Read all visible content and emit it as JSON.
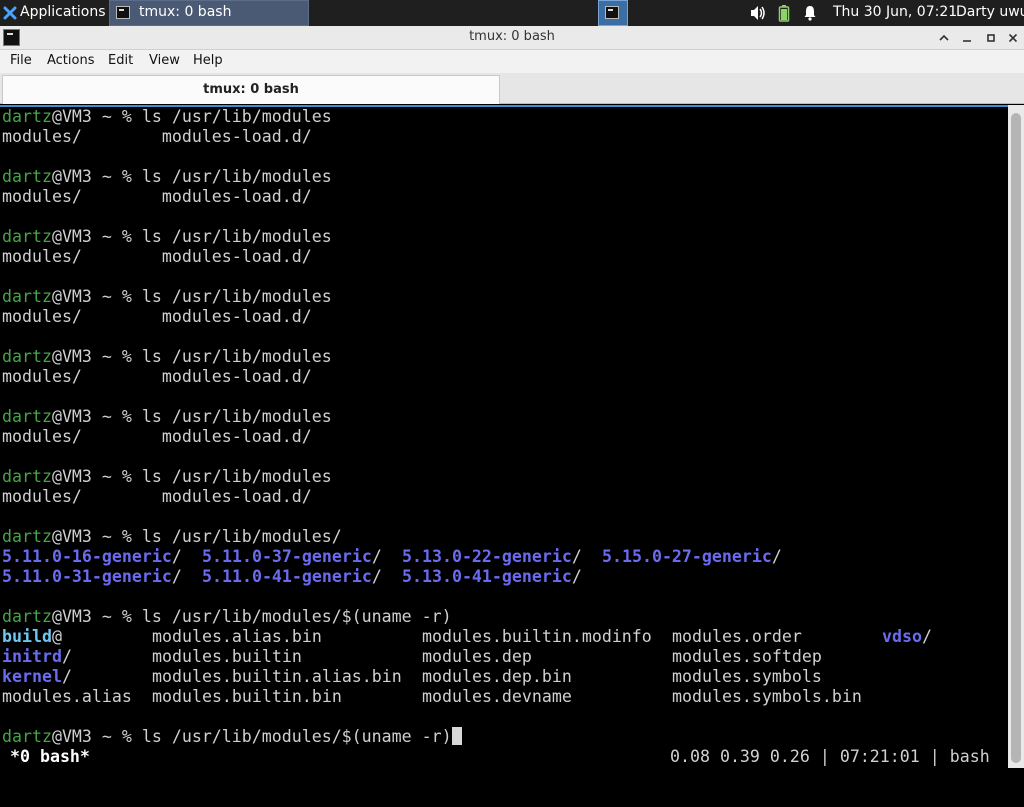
{
  "panel": {
    "applications_label": "Applications",
    "task_label": "tmux: 0 bash",
    "clock": "Thu 30 Jun, 07:21",
    "user": "Darty uwu",
    "icons": [
      "xfce-logo-icon",
      "terminal-icon",
      "volume-icon",
      "battery-icon",
      "notification-bell-icon"
    ]
  },
  "window": {
    "title": "tmux: 0 bash",
    "menu": [
      "File",
      "Actions",
      "Edit",
      "View",
      "Help"
    ],
    "tab_label": "tmux: 0 bash"
  },
  "colors": {
    "prompt_user": "#46a346",
    "directory": "#6b6bf0",
    "symlink": "#6ec8f2",
    "text": "#d0d0d0",
    "background": "#000000",
    "focus_border": "#3d8fd6"
  },
  "terminal": {
    "prompt_user": "dartz",
    "prompt_rest": "@VM3 ~ % ",
    "blocks": [
      {
        "cmd": "ls /usr/lib/modules",
        "out": "modules/        modules-load.d/"
      },
      {
        "cmd": "ls /usr/lib/modules",
        "out": "modules/        modules-load.d/"
      },
      {
        "cmd": "ls /usr/lib/modules",
        "out": "modules/        modules-load.d/"
      },
      {
        "cmd": "ls /usr/lib/modules",
        "out": "modules/        modules-load.d/"
      },
      {
        "cmd": "ls /usr/lib/modules",
        "out": "modules/        modules-load.d/"
      },
      {
        "cmd": "ls /usr/lib/modules",
        "out": "modules/        modules-load.d/"
      },
      {
        "cmd": "ls /usr/lib/modules",
        "out": "modules/        modules-load.d/"
      }
    ],
    "cmd8": "ls /usr/lib/modules/",
    "kernels": [
      [
        "5.11.0-16-generic",
        "5.11.0-37-generic",
        "5.13.0-22-generic",
        "5.15.0-27-generic"
      ],
      [
        "5.11.0-31-generic",
        "5.11.0-41-generic",
        "5.13.0-41-generic"
      ]
    ],
    "cmd9": "ls /usr/lib/modules/$(uname -r)",
    "listing": {
      "build": "build",
      "build_suffix": "@",
      "initrd": "initrd",
      "kernel": "kernel",
      "vdso": "vdso",
      "col1_row4": "modules.alias",
      "col2": [
        "modules.alias.bin",
        "modules.builtin",
        "modules.builtin.alias.bin",
        "modules.builtin.bin"
      ],
      "col3": [
        "modules.builtin.modinfo",
        "modules.dep",
        "modules.dep.bin",
        "modules.devname"
      ],
      "col4": [
        "modules.order",
        "modules.softdep",
        "modules.symbols",
        "modules.symbols.bin"
      ]
    },
    "cmd10": "ls /usr/lib/modules/$(uname -r)",
    "status_left": " *0 bash*",
    "status_right": "0.08 0.39 0.26 | 07:21:01 | bash"
  }
}
